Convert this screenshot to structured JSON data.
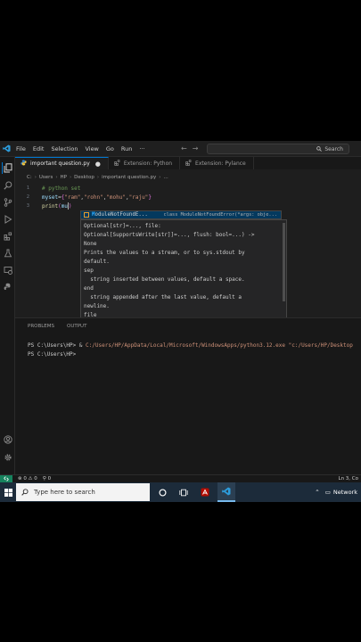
{
  "menu": [
    "File",
    "Edit",
    "Selection",
    "View",
    "Go",
    "Run",
    "···"
  ],
  "search_label": "Search",
  "tabs": [
    {
      "label": "important question.py",
      "dirty": "●"
    },
    {
      "label": "Extension: Python"
    },
    {
      "label": "Extension: Pylance"
    }
  ],
  "breadcrumb": [
    "C:",
    "Users",
    "HP",
    "Desktop",
    "important question.py",
    "..."
  ],
  "code": [
    {
      "ln": "1",
      "comment": "# python set"
    },
    {
      "ln": "2",
      "var": "myset",
      "op": "=",
      "open": "{",
      "items": [
        "\"ram\"",
        ",",
        "\"rohn\"",
        ",",
        "\"mohu\"",
        ",",
        "\"raju\""
      ],
      "close": "}"
    },
    {
      "ln": "3",
      "fn": "print",
      "open": "(",
      "arg": "mu",
      "close": ")"
    }
  ],
  "suggest": {
    "highlight": "M",
    "rest": "oduleNotFoundE...",
    "detail": "class ModuleNotFoundError(*args: obje..."
  },
  "hover_lines": [
    "Optional[str]=..., file:",
    "Optional[SupportsWrite[str]]=..., flush: bool=...) ->",
    "None",
    "",
    "Prints the values to a stream, or to sys.stdout by",
    "default.",
    "",
    "sep",
    "  string inserted between values, default a space.",
    "end",
    "  string appended after the last value, default a",
    "newline.",
    "file"
  ],
  "panel_tabs": [
    "PROBLEMS",
    "OUTPUT"
  ],
  "terminal": {
    "line1_prompt": "PS C:\\Users\\HP> & ",
    "line1_path": "C:/Users/HP/AppData/Local/Microsoft/WindowsApps/python3.12.exe",
    "line1_arg": "\"c:/Users/HP/Desktop",
    "line2": "PS C:\\Users\\HP>"
  },
  "status": {
    "errors": "0",
    "warnings": "0",
    "info": "0",
    "position": "Ln 3, Co"
  },
  "taskbar": {
    "search_placeholder": "Type here to search",
    "network": "Network"
  }
}
